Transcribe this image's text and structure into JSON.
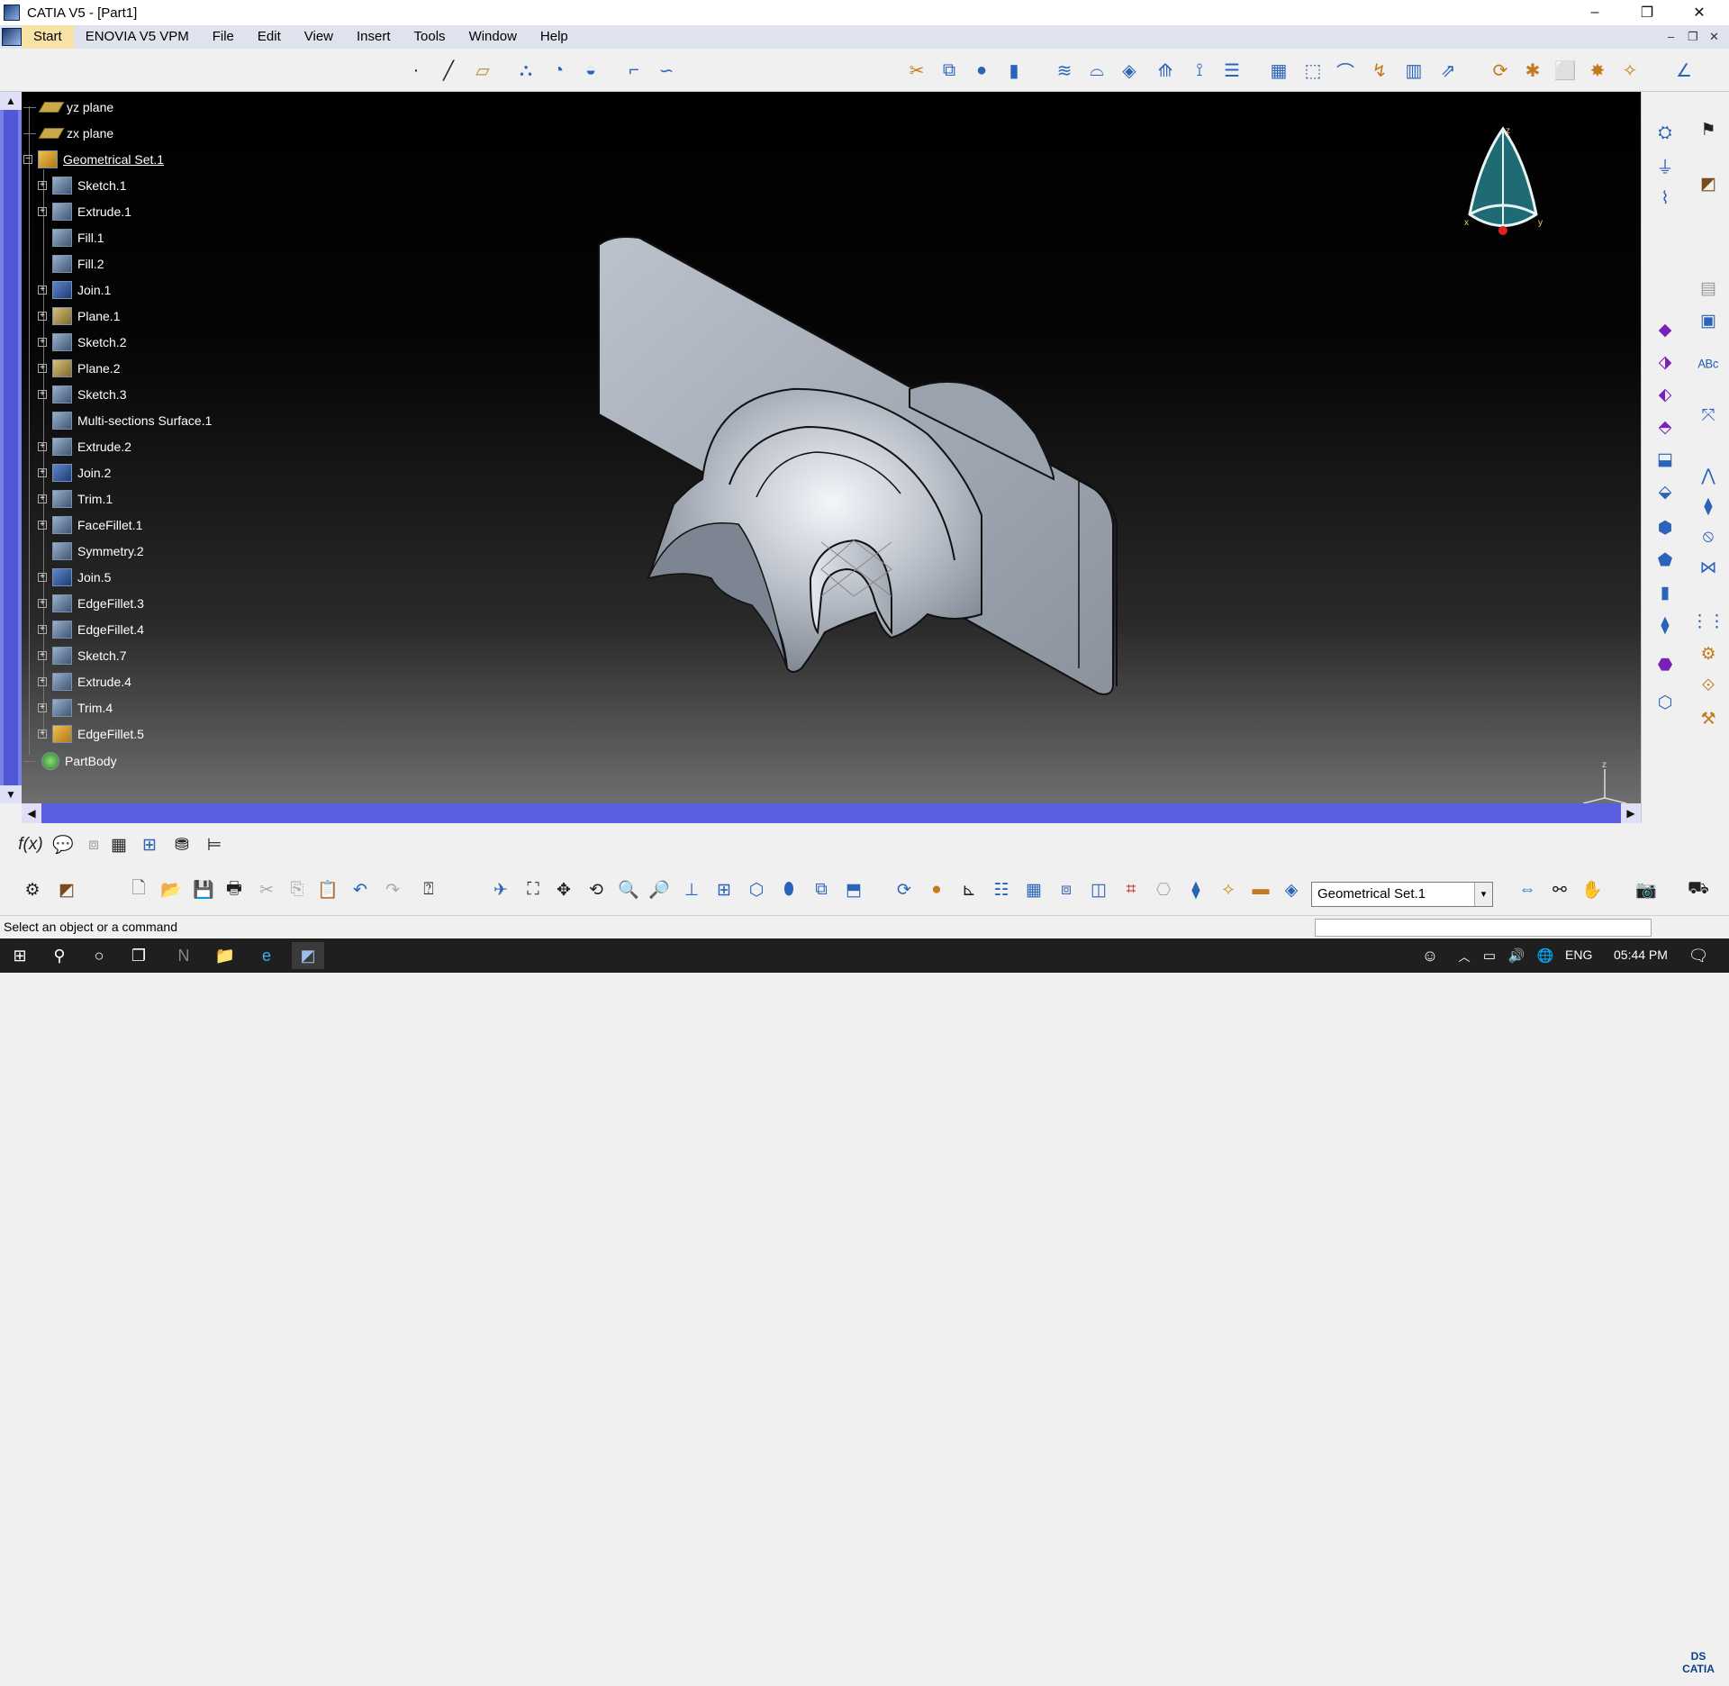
{
  "window": {
    "title": "CATIA V5 - [Part1]",
    "minimize": "–",
    "restore": "❐",
    "close": "✕"
  },
  "menu": {
    "items": [
      "Start",
      "ENOVIA V5 VPM",
      "File",
      "Edit",
      "View",
      "Insert",
      "Tools",
      "Window",
      "Help"
    ],
    "mdi_minimize": "–",
    "mdi_restore": "❐",
    "mdi_close": "✕"
  },
  "tree": {
    "items": [
      {
        "label": "yz plane",
        "type": "plane"
      },
      {
        "label": "zx plane",
        "type": "plane"
      },
      {
        "label": "Geometrical Set.1",
        "type": "set"
      },
      {
        "label": "Sketch.1",
        "type": "feature"
      },
      {
        "label": "Extrude.1",
        "type": "feature"
      },
      {
        "label": "Fill.1",
        "type": "feature"
      },
      {
        "label": "Fill.2",
        "type": "feature"
      },
      {
        "label": "Join.1",
        "type": "feature"
      },
      {
        "label": "Plane.1",
        "type": "feature"
      },
      {
        "label": "Sketch.2",
        "type": "feature"
      },
      {
        "label": "Plane.2",
        "type": "feature"
      },
      {
        "label": "Sketch.3",
        "type": "feature"
      },
      {
        "label": "Multi-sections Surface.1",
        "type": "feature"
      },
      {
        "label": "Extrude.2",
        "type": "feature"
      },
      {
        "label": "Join.2",
        "type": "feature"
      },
      {
        "label": "Trim.1",
        "type": "feature"
      },
      {
        "label": "FaceFillet.1",
        "type": "feature"
      },
      {
        "label": "Symmetry.2",
        "type": "feature"
      },
      {
        "label": "Join.5",
        "type": "feature"
      },
      {
        "label": "EdgeFillet.3",
        "type": "feature"
      },
      {
        "label": "EdgeFillet.4",
        "type": "feature"
      },
      {
        "label": "Sketch.7",
        "type": "feature"
      },
      {
        "label": "Extrude.4",
        "type": "feature"
      },
      {
        "label": "Trim.4",
        "type": "feature"
      },
      {
        "label": "EdgeFillet.5",
        "type": "feature"
      },
      {
        "label": "PartBody",
        "type": "body"
      }
    ]
  },
  "compass": {
    "z_label": "z",
    "x_label": "x",
    "y_label": "y"
  },
  "axis": {
    "z_label": "z"
  },
  "ds_logo": {
    "line1": "DS",
    "line2": "CATIA"
  },
  "toolbar": {
    "current_set": "Geometrical Set.1",
    "dropdown_arrow": "▾"
  },
  "status": {
    "message": "Select an object or a command"
  },
  "taskbar": {
    "language": "ENG",
    "time": "05:44 PM"
  },
  "icons": {
    "top": [
      "point-icon",
      "line-icon",
      "plane-icon",
      "extrude-icon",
      "revolve-icon",
      "sweep-icon",
      "fillet-icon",
      "connect-curve-icon",
      "split-icon",
      "trim-icon",
      "sphere-icon",
      "cylinder-icon",
      "offset-icon",
      "blend-icon",
      "fill-icon",
      "multisection-icon",
      "healing-icon",
      "layer-icon",
      "join-icon",
      "extract-icon",
      "parallel-curve-icon",
      "boundary-icon",
      "pattern-icon",
      "translate-icon",
      "rotate-icon",
      "symmetry-icon",
      "scaling-icon",
      "axis-system-icon",
      "extrapolate-icon",
      "curve-analysis-icon"
    ],
    "colors": {
      "accent": "#5a5fe0",
      "scrollbar": "#7b7fe8",
      "menu_active": "#f7e2a8",
      "compass": "#1f6b73"
    }
  }
}
